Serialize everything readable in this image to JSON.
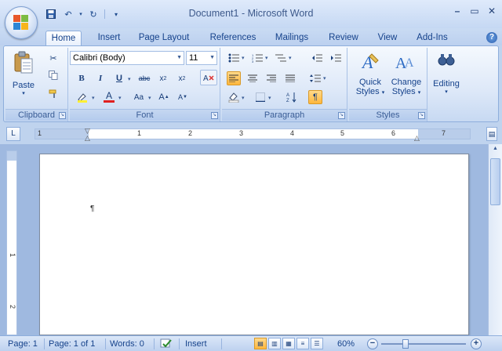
{
  "window": {
    "title": "Document1 - Microsoft Word",
    "controls": [
      "–",
      "▭",
      "✕"
    ]
  },
  "quick_access": {
    "icons": [
      "save-icon",
      "undo-icon",
      "redo-icon",
      "customize-icon"
    ]
  },
  "tabs": [
    {
      "label": "Home",
      "active": true
    },
    {
      "label": "Insert"
    },
    {
      "label": "Page Layout"
    },
    {
      "label": "References"
    },
    {
      "label": "Mailings"
    },
    {
      "label": "Review"
    },
    {
      "label": "View"
    },
    {
      "label": "Add-Ins"
    }
  ],
  "ribbon": {
    "clipboard": {
      "label": "Clipboard",
      "paste": "Paste"
    },
    "font": {
      "label": "Font",
      "font_name": "Calibri (Body)",
      "font_size": "11"
    },
    "paragraph": {
      "label": "Paragraph"
    },
    "styles": {
      "label": "Styles",
      "quick_styles_1": "Quick",
      "quick_styles_2": "Styles",
      "change_styles_1": "Change",
      "change_styles_2": "Styles"
    },
    "editing": {
      "label": "Editing"
    }
  },
  "ruler": {
    "numbers": [
      "1",
      "1",
      "2",
      "3",
      "4",
      "5",
      "6",
      "7"
    ],
    "vnumbers": [
      "1",
      "2"
    ]
  },
  "document": {
    "pilcrow": "¶"
  },
  "statusbar": {
    "page": "Page: 1",
    "page_of": "Page: 1 of 1",
    "words": "Words: 0",
    "mode": "Insert",
    "zoom": "60%"
  },
  "colors": {
    "accent": "#15428b",
    "ribbon_bg": "#dde8f8",
    "active_button": "#ffb73d",
    "font_color_bar": "#e02020"
  }
}
